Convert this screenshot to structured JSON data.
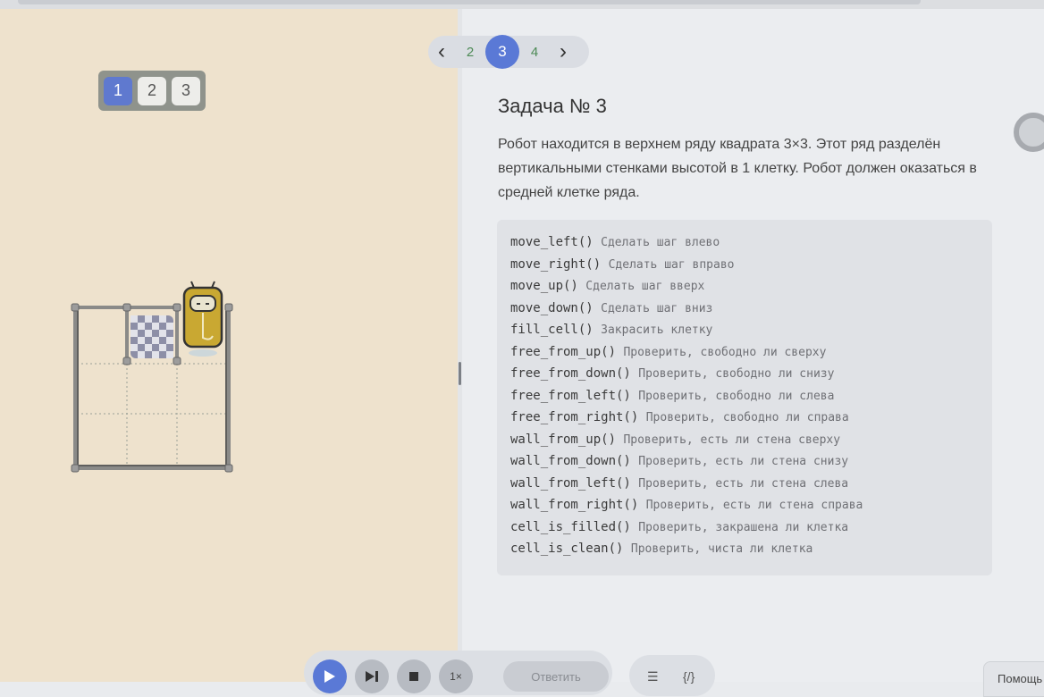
{
  "levels": {
    "items": [
      "1",
      "2",
      "3"
    ],
    "active": "1"
  },
  "pager": {
    "items": [
      "2",
      "3",
      "4"
    ],
    "active": "3"
  },
  "task": {
    "title": "Задача № 3",
    "description": "Робот находится в верхнем ряду квадрата 3×3. Этот ряд разделён вертикальными стенками высотой в 1 клетку. Робот должен оказаться в средней клетке ряда."
  },
  "commands": [
    {
      "fn": "move_left()",
      "desc": "Сделать шаг влево"
    },
    {
      "fn": "move_right()",
      "desc": "Сделать шаг вправо"
    },
    {
      "fn": "move_up()",
      "desc": "Сделать шаг вверх"
    },
    {
      "fn": "move_down()",
      "desc": "Сделать шаг вниз"
    },
    {
      "fn": "fill_cell()",
      "desc": "Закрасить клетку"
    },
    {
      "fn": "free_from_up()",
      "desc": "Проверить, свободно ли сверху"
    },
    {
      "fn": "free_from_down()",
      "desc": "Проверить, свободно ли снизу"
    },
    {
      "fn": "free_from_left()",
      "desc": "Проверить, свободно ли слева"
    },
    {
      "fn": "free_from_right()",
      "desc": "Проверить, свободно ли справа"
    },
    {
      "fn": "wall_from_up()",
      "desc": "Проверить, есть ли стена сверху"
    },
    {
      "fn": "wall_from_down()",
      "desc": "Проверить, есть ли стена снизу"
    },
    {
      "fn": "wall_from_left()",
      "desc": "Проверить, есть ли стена слева"
    },
    {
      "fn": "wall_from_right()",
      "desc": "Проверить, есть ли стена справа"
    },
    {
      "fn": "cell_is_filled()",
      "desc": "Проверить, закрашена ли клетка"
    },
    {
      "fn": "cell_is_clean()",
      "desc": "Проверить, чиста ли клетка"
    }
  ],
  "toolbar": {
    "speed_label": "1×",
    "answer_label": "Ответить",
    "view_list_icon": "list-icon",
    "view_code_label": "{/}"
  },
  "help_label": "Помощь",
  "colors": {
    "left_bg": "#eee2cd",
    "accent": "#5a79d6",
    "robot": "#c9a832",
    "pager_num": "#4d8a56"
  }
}
